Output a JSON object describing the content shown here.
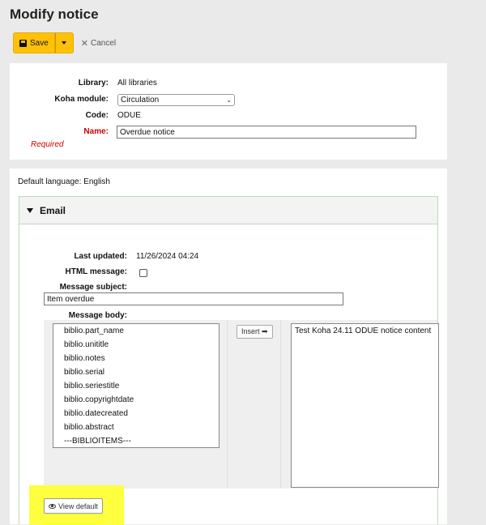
{
  "page": {
    "title": "Modify notice"
  },
  "toolbar": {
    "save_label": "Save",
    "cancel_label": "Cancel"
  },
  "form": {
    "library_label": "Library:",
    "library_value": "All libraries",
    "module_label": "Koha module:",
    "module_value": "Circulation",
    "code_label": "Code:",
    "code_value": "ODUE",
    "name_label": "Name:",
    "name_value": "Overdue notice",
    "required_label": "Required"
  },
  "language": {
    "default_label": "Default language: English"
  },
  "email": {
    "heading": "Email",
    "last_updated_label": "Last updated:",
    "last_updated_value": "11/26/2024 04:24",
    "html_message_label": "HTML message:",
    "subject_label": "Message subject:",
    "subject_value": "Item overdue",
    "body_label": "Message body:",
    "fields": [
      "biblio.part_name",
      "biblio.unititle",
      "biblio.notes",
      "biblio.serial",
      "biblio.seriestitle",
      "biblio.copyrightdate",
      "biblio.datecreated",
      "biblio.abstract",
      "---BIBLIOITEMS---"
    ],
    "insert_label": "Insert ➡",
    "body_value": "Test Koha 24.11 ODUE notice content",
    "view_default_label": "View default"
  },
  "colors": {
    "save_button": "#ffc107",
    "highlight": "#fdff3f",
    "required": "#cc0000",
    "email_border": "#b8dcb8"
  }
}
